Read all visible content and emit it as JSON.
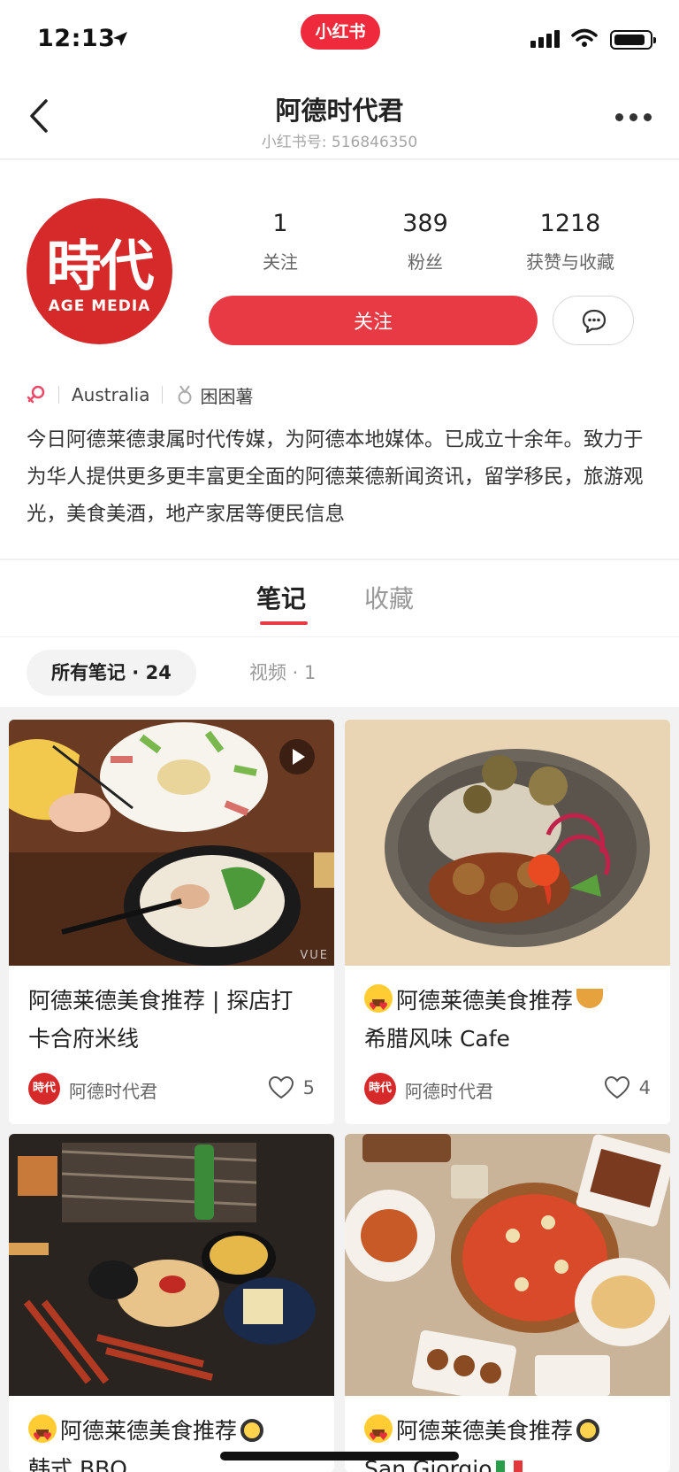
{
  "status_bar": {
    "time": "12:13",
    "brand": "小红书",
    "battery_level": 0.9
  },
  "header": {
    "title": "阿德时代君",
    "subtitle": "小红书号: 516846350"
  },
  "profile": {
    "avatar_big": "時代",
    "avatar_small": "AGE MEDIA",
    "stats": [
      {
        "value": "1",
        "label": "关注"
      },
      {
        "value": "389",
        "label": "粉丝"
      },
      {
        "value": "1218",
        "label": "获赞与收藏"
      }
    ],
    "follow_label": "关注",
    "location": "Australia",
    "tag": "困困薯",
    "bio": "今日阿德莱德隶属时代传媒，为阿德本地媒体。已成立十余年。致力于为华人提供更多更丰富更全面的阿德莱德新闻资讯，留学移民，旅游观光，美食美酒，地产家居等便民信息"
  },
  "tabs": [
    {
      "label": "笔记"
    },
    {
      "label": "收藏"
    }
  ],
  "filters": [
    {
      "label": "所有笔记 · 24"
    },
    {
      "label": "视频 · 1"
    }
  ],
  "notes": [
    {
      "title": "阿德莱德美食推荐 | 探店打卡合府米线",
      "author": "阿德时代君",
      "likes": "5",
      "watermark": "VUE"
    },
    {
      "title": "阿德莱德美食推荐",
      "title_line2": "希腊风味 Cafe",
      "author": "阿德时代君",
      "likes": "4"
    },
    {
      "title": "阿德莱德美食推荐",
      "title_line2": "韩式 BBQ"
    },
    {
      "title": "阿德莱德美食推荐",
      "title_line2": "San Giorgio"
    }
  ],
  "colors": {
    "accent": "#e83a44",
    "brand": "#ee2a3c"
  }
}
